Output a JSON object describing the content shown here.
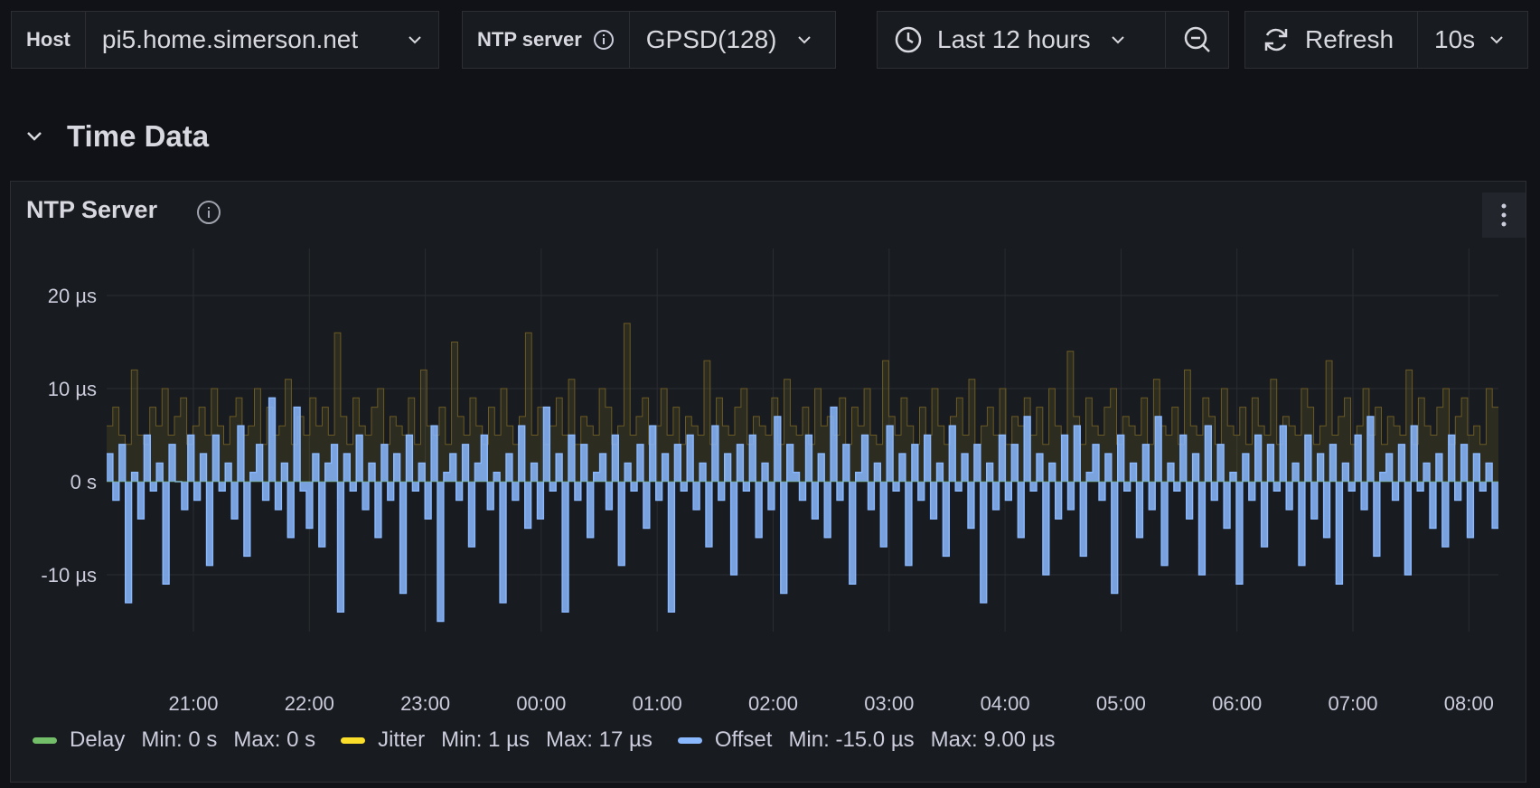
{
  "toolbar": {
    "host": {
      "label": "Host",
      "value": "pi5.home.simerson.net"
    },
    "ntp": {
      "label": "NTP server",
      "value": "GPSD(128)"
    },
    "time_range": "Last 12 hours",
    "refresh_label": "Refresh",
    "refresh_interval": "10s"
  },
  "row": {
    "title": "Time Data"
  },
  "panel": {
    "title": "NTP Server",
    "legend": [
      {
        "name": "Delay",
        "color": "#73bf69",
        "min": "Min: 0 s",
        "max": "Max: 0 s"
      },
      {
        "name": "Jitter",
        "color": "#fade2a",
        "min": "Min: 1 µs",
        "max": "Max: 17 µs"
      },
      {
        "name": "Offset",
        "color": "#8ab8ff",
        "min": "Min: -15.0 µs",
        "max": "Max: 9.00 µs"
      }
    ]
  },
  "chart_data": {
    "type": "line",
    "x_ticks": [
      "21:00",
      "22:00",
      "23:00",
      "00:00",
      "01:00",
      "02:00",
      "03:00",
      "04:00",
      "05:00",
      "06:00",
      "07:00",
      "08:00"
    ],
    "y_ticks": [
      "20 µs",
      "10 µs",
      "0 s",
      "-10 µs"
    ],
    "ylim": [
      -15,
      20
    ],
    "unit": "µs",
    "series": [
      {
        "name": "Delay",
        "color": "#73bf69",
        "values": [
          0,
          0
        ]
      },
      {
        "name": "Jitter",
        "color": "#fade2a",
        "values": [
          6,
          8,
          5,
          4,
          12,
          5,
          4,
          8,
          6,
          10,
          5,
          7,
          9,
          4,
          6,
          8,
          5,
          10,
          6,
          4,
          7,
          9,
          5,
          6,
          10,
          4,
          8,
          5,
          6,
          11,
          4,
          7,
          5,
          9,
          6,
          8,
          5,
          16,
          7,
          4,
          9,
          6,
          5,
          8,
          10,
          4,
          7,
          6,
          5,
          9,
          4,
          12,
          6,
          5,
          8,
          4,
          15,
          7,
          5,
          9,
          6,
          4,
          8,
          5,
          10,
          6,
          4,
          7,
          16,
          5,
          8,
          4,
          6,
          9,
          5,
          11,
          4,
          7,
          6,
          5,
          10,
          8,
          4,
          6,
          17,
          5,
          7,
          9,
          4,
          6,
          10,
          5,
          8,
          4,
          7,
          6,
          5,
          13,
          4,
          9,
          6,
          5,
          8,
          10,
          4,
          7,
          6,
          5,
          9,
          4,
          11,
          6,
          5,
          8,
          4,
          10,
          6,
          7,
          5,
          9,
          4,
          8,
          6,
          10,
          5,
          4,
          13,
          7,
          5,
          9,
          6,
          4,
          8,
          5,
          10,
          6,
          4,
          7,
          9,
          5,
          11,
          4,
          6,
          8,
          5,
          10,
          4,
          7,
          6,
          9,
          5,
          8,
          4,
          10,
          6,
          5,
          14,
          7,
          4,
          9,
          6,
          5,
          8,
          10,
          4,
          7,
          6,
          5,
          9,
          4,
          11,
          6,
          5,
          8,
          4,
          12,
          6,
          5,
          9,
          7,
          4,
          10,
          6,
          5,
          8,
          4,
          9,
          6,
          5,
          11,
          4,
          7,
          6,
          5,
          10,
          8,
          4,
          6,
          13,
          5,
          7,
          9,
          4,
          6,
          10,
          5,
          8,
          4,
          7,
          6,
          5,
          12,
          4,
          9,
          6,
          5,
          8,
          10,
          4,
          7,
          9,
          5,
          6,
          4,
          10,
          8
        ]
      },
      {
        "name": "Offset",
        "color": "#8ab8ff",
        "values": [
          3,
          -2,
          4,
          -13,
          1,
          -4,
          5,
          -1,
          2,
          -11,
          4,
          0,
          -3,
          5,
          -2,
          3,
          -9,
          5,
          -1,
          2,
          -4,
          6,
          -8,
          1,
          4,
          -2,
          9,
          -3,
          2,
          -6,
          8,
          -1,
          -5,
          3,
          -7,
          2,
          4,
          -14,
          3,
          -1,
          5,
          -3,
          2,
          -6,
          4,
          -2,
          3,
          -12,
          5,
          -1,
          2,
          -4,
          6,
          -15,
          1,
          3,
          -2,
          4,
          -7,
          2,
          5,
          -3,
          1,
          -13,
          3,
          -2,
          6,
          -5,
          2,
          -4,
          8,
          -1,
          3,
          -14,
          5,
          -2,
          4,
          -6,
          1,
          3,
          -3,
          5,
          -9,
          2,
          -1,
          4,
          -5,
          6,
          -2,
          3,
          -14,
          4,
          -1,
          5,
          -3,
          2,
          -7,
          6,
          -2,
          3,
          -10,
          4,
          -1,
          5,
          -6,
          2,
          -3,
          7,
          -12,
          4,
          1,
          -2,
          5,
          -4,
          3,
          -6,
          8,
          -2,
          4,
          -11,
          1,
          5,
          -3,
          2,
          -7,
          6,
          -1,
          3,
          -9,
          4,
          -2,
          5,
          -4,
          2,
          -8,
          6,
          -1,
          3,
          -5,
          4,
          -13,
          2,
          -3,
          5,
          -2,
          4,
          -6,
          7,
          -1,
          3,
          -10,
          2,
          -4,
          5,
          -3,
          6,
          -8,
          1,
          4,
          -2,
          3,
          -12,
          5,
          -1,
          2,
          -6,
          4,
          -3,
          7,
          -9,
          2,
          -1,
          5,
          -4,
          3,
          -10,
          6,
          -2,
          4,
          -5,
          1,
          -11,
          3,
          -2,
          5,
          -7,
          4,
          -1,
          6,
          -3,
          2,
          -9,
          5,
          -4,
          3,
          -6,
          4,
          -11,
          2,
          -1,
          5,
          -3,
          7,
          -8,
          1,
          3,
          -2,
          4,
          -10,
          6,
          -1,
          2,
          -5,
          3,
          -7,
          5,
          -2,
          4,
          -6,
          3,
          -1,
          2,
          -5
        ]
      }
    ],
    "grid": true
  }
}
